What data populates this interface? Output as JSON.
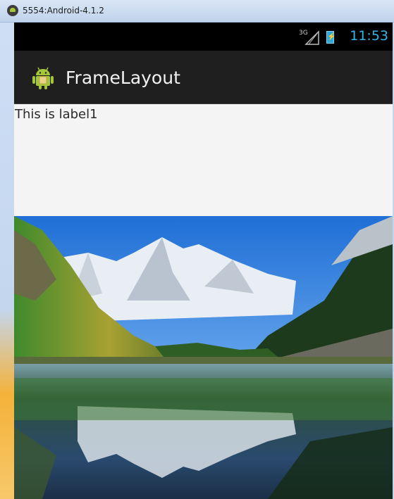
{
  "window": {
    "title": "5554:Android-4.1.2",
    "icon": "android-emulator-icon"
  },
  "status_bar": {
    "network_type": "3G",
    "signal_icon": "signal-icon",
    "battery_icon": "battery-charging-icon",
    "time": "11:53",
    "time_color": "#33b5e5"
  },
  "action_bar": {
    "app_icon": "android-app-icon",
    "title": "FrameLayout"
  },
  "content": {
    "label1": "This is label1",
    "image": "mountain-lake-landscape-image"
  },
  "colors": {
    "action_bar_bg": "#1f1f1f",
    "status_bar_bg": "#000000",
    "content_bg": "#f4f4f4"
  }
}
